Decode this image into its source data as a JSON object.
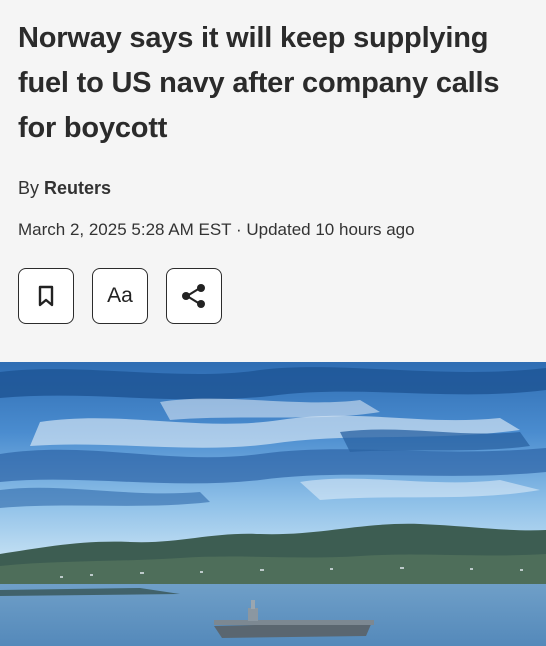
{
  "article": {
    "headline": "Norway says it will keep supplying fuel to US navy after company calls for boycott",
    "byline_prefix": "By",
    "author": "Reuters",
    "dateline": "March 2, 2025 5:28 AM EST · Updated 10 hours ago"
  },
  "actions": [
    {
      "name": "bookmark",
      "icon": "bookmark-icon"
    },
    {
      "name": "text-size",
      "label": "Aa"
    },
    {
      "name": "share",
      "icon": "share-icon"
    }
  ],
  "hero_image": {
    "subject": "aircraft carrier in a fjord under a blue cloudy sky"
  }
}
